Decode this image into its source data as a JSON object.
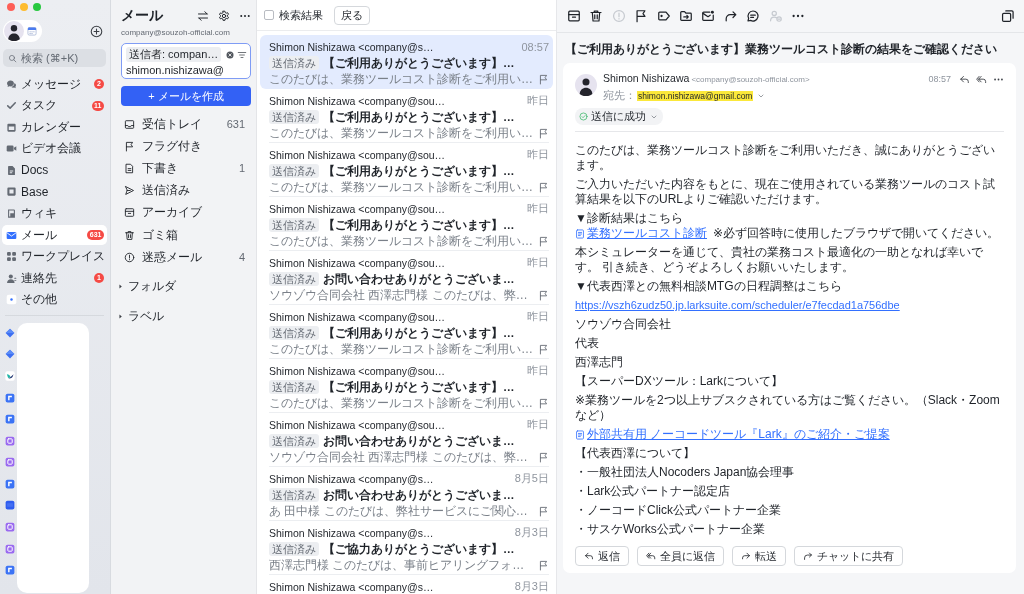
{
  "sidebar": {
    "search": {
      "placeholder": "検索 (⌘+K)"
    },
    "items": [
      {
        "label": "メッセージ",
        "badge": "2",
        "selected": false
      },
      {
        "label": "タスク",
        "badge": "11",
        "selected": false
      },
      {
        "label": "カレンダー",
        "selected": false
      },
      {
        "label": "ビデオ会議",
        "selected": false
      },
      {
        "label": "Docs",
        "selected": false
      },
      {
        "label": "Base",
        "selected": false
      },
      {
        "label": "ウィキ",
        "selected": false
      },
      {
        "label": "メール",
        "badge": "631",
        "selected": true
      },
      {
        "label": "ワークプレイス",
        "selected": false
      },
      {
        "label": "連絡先",
        "badge": "1",
        "selected": false
      },
      {
        "label": "その他",
        "selected": false
      }
    ]
  },
  "mail_nav": {
    "title": "メール",
    "account": "company@souzoh-official.com",
    "search": {
      "filter_chip": "送信者: compan…",
      "value": "shimon.nishizawa@"
    },
    "compose_button": "+ メールを作成",
    "folders": [
      {
        "label": "受信トレイ",
        "count": "631",
        "selected": false
      },
      {
        "label": "フラグ付き",
        "selected": false
      },
      {
        "label": "下書き",
        "count": "1",
        "selected": false
      },
      {
        "label": "送信済み",
        "selected": false
      },
      {
        "label": "アーカイブ",
        "selected": false
      },
      {
        "label": "ゴミ箱",
        "selected": false
      },
      {
        "label": "迷惑メール",
        "count": "4",
        "selected": false
      }
    ],
    "groups": [
      {
        "label": "フォルダ",
        "expanded": false
      },
      {
        "label": "ラベル",
        "expanded": false
      }
    ]
  },
  "message_list": {
    "select_all_checked": false,
    "title": "検索結果",
    "back_button": "戻る",
    "messages": [
      {
        "sender": "Shimon Nishizawa <company@s…",
        "time": "08:57",
        "tag": "送信済み",
        "subject": "【ご利用ありがとうございます】…",
        "preview": "このたびは、業務ツールコスト診断をご利用い…",
        "flagged": false,
        "selected": true
      },
      {
        "sender": "Shimon Nishizawa <company@sou…",
        "time": "昨日",
        "tag": "送信済み",
        "subject": "【ご利用ありがとうございます】…",
        "preview": "このたびは、業務ツールコスト診断をご利用い…",
        "flagged": false,
        "selected": false
      },
      {
        "sender": "Shimon Nishizawa <company@sou…",
        "time": "昨日",
        "tag": "送信済み",
        "subject": "【ご利用ありがとうございます】…",
        "preview": "このたびは、業務ツールコスト診断をご利用い…",
        "flagged": false,
        "selected": false
      },
      {
        "sender": "Shimon Nishizawa <company@sou…",
        "time": "昨日",
        "tag": "送信済み",
        "subject": "【ご利用ありがとうございます】…",
        "preview": "このたびは、業務ツールコスト診断をご利用い…",
        "flagged": false,
        "selected": false
      },
      {
        "sender": "Shimon Nishizawa <company@sou…",
        "time": "昨日",
        "tag": "送信済み",
        "subject": "お問い合わせありがとうございま…",
        "preview": "ソウゾウ合同会社 西澤志門様 このたびは、弊…",
        "flagged": false,
        "selected": false
      },
      {
        "sender": "Shimon Nishizawa <company@sou…",
        "time": "昨日",
        "tag": "送信済み",
        "subject": "【ご利用ありがとうございます】…",
        "preview": "このたびは、業務ツールコスト診断をご利用い…",
        "flagged": false,
        "selected": false
      },
      {
        "sender": "Shimon Nishizawa <company@sou…",
        "time": "昨日",
        "tag": "送信済み",
        "subject": "【ご利用ありがとうございます】…",
        "preview": "このたびは、業務ツールコスト診断をご利用い…",
        "flagged": false,
        "selected": false
      },
      {
        "sender": "Shimon Nishizawa <company@sou…",
        "time": "昨日",
        "tag": "送信済み",
        "subject": "お問い合わせありがとうございま…",
        "preview": "ソウゾウ合同会社 西澤志門様 このたびは、弊…",
        "flagged": false,
        "selected": false
      },
      {
        "sender": "Shimon Nishizawa <company@s…",
        "time": "8月5日",
        "tag": "送信済み",
        "subject": "お問い合わせありがとうございま…",
        "preview": "あ 田中様 このたびは、弊社サービスにご関心…",
        "flagged": false,
        "selected": false
      },
      {
        "sender": "Shimon Nishizawa <company@s…",
        "time": "8月3日",
        "tag": "送信済み",
        "subject": "【ご協力ありがとうございます】…",
        "preview": "西澤志門様 このたびは、事前ヒアリングフォ…",
        "flagged": false,
        "selected": false
      },
      {
        "sender": "Shimon Nishizawa <company@s…",
        "time": "8月3日",
        "selected": false
      }
    ]
  },
  "reading_pane": {
    "toolbar": [
      {
        "disabled": false
      },
      {
        "disabled": false
      },
      {
        "disabled": true
      },
      {
        "disabled": false
      },
      {
        "disabled": false
      },
      {
        "disabled": false
      },
      {
        "disabled": false
      },
      {
        "disabled": false
      },
      {
        "disabled": false
      },
      {
        "disabled": true
      },
      {
        "disabled": false
      }
    ],
    "subject": "【ご利用ありがとうございます】業務ツールコスト診断の結果をご確認ください",
    "sender": {
      "name": "Shimon Nishizawa",
      "address": "<company@souzoh-official.com>"
    },
    "time": "08:57",
    "to_label": "宛先：",
    "to": {
      "address": "shimon.nishizawa@gmail.com",
      "highlighted": true
    },
    "status": "送信に成功",
    "body": [
      {
        "lines": [
          [
            {
              "kind": "text",
              "text": "このたびは、業務ツールコスト診断をご利用いただき、誠にありがとうございます。"
            }
          ]
        ]
      },
      {
        "lines": [
          [
            {
              "kind": "text",
              "text": "ご入力いただいた内容をもとに、現在ご使用されている業務ツールのコスト試算結果を以下のURLよりご確認いただけます。"
            }
          ]
        ]
      },
      {
        "lines": [
          [
            {
              "kind": "text",
              "text": "▼診断結果はこちら"
            }
          ],
          [
            {
              "kind": "doc_link",
              "text": "業務ツールコスト診断"
            },
            {
              "kind": "text",
              "text": "※必ず回答時に使用したブラウザで開いてください。"
            }
          ]
        ]
      },
      {
        "lines": [
          [
            {
              "kind": "text",
              "text": "本シミュレーターを通じて、貴社の業務コスト最適化の一助となれば幸いです。 引き続き、どうぞよろしくお願いいたします。"
            }
          ]
        ]
      },
      {
        "lines": [
          [
            {
              "kind": "text",
              "text": "▼代表西澤との無料相談MTGの日程調整はこちら"
            }
          ]
        ]
      },
      {
        "lines": [
          [
            {
              "kind": "link",
              "text": "https://vszh6zudz50.jp.larksuite.com/scheduler/e7fecdad1a756dbe"
            }
          ]
        ]
      },
      {
        "lines": [
          [
            {
              "kind": "text",
              "text": "ソウゾウ合同会社"
            }
          ]
        ]
      },
      {
        "lines": [
          [
            {
              "kind": "text",
              "text": "代表"
            }
          ]
        ]
      },
      {
        "lines": [
          [
            {
              "kind": "text",
              "text": "西澤志門"
            }
          ]
        ]
      },
      {
        "lines": [
          [
            {
              "kind": "text",
              "text": "【スーパーDXツール：Larkについて】"
            }
          ]
        ]
      },
      {
        "lines": [
          [
            {
              "kind": "text",
              "text": "※業務ツールを2つ以上サブスクされている方はご覧ください。（Slack・Zoomなど）"
            }
          ]
        ]
      },
      {
        "lines": [
          [
            {
              "kind": "doc_link",
              "text": "外部共有用 ノーコードツール『Lark』のご紹介・ご提案"
            }
          ]
        ]
      },
      {
        "lines": [
          [
            {
              "kind": "text",
              "text": "【代表西澤について】"
            }
          ]
        ]
      },
      {
        "lines": [
          [
            {
              "kind": "text",
              "text": "・一般社団法人Nocoders Japan協会理事"
            }
          ]
        ]
      },
      {
        "lines": [
          [
            {
              "kind": "text",
              "text": "・Lark公式パートナー認定店"
            }
          ]
        ]
      },
      {
        "lines": [
          [
            {
              "kind": "text",
              "text": "・ノーコードClick公式パートナー企業"
            }
          ]
        ]
      },
      {
        "lines": [
          [
            {
              "kind": "text",
              "text": "・サスケWorks公式パートナー企業"
            }
          ]
        ]
      }
    ],
    "actions": [
      "返信",
      "全員に返信",
      "転送",
      "チャットに共有"
    ]
  }
}
